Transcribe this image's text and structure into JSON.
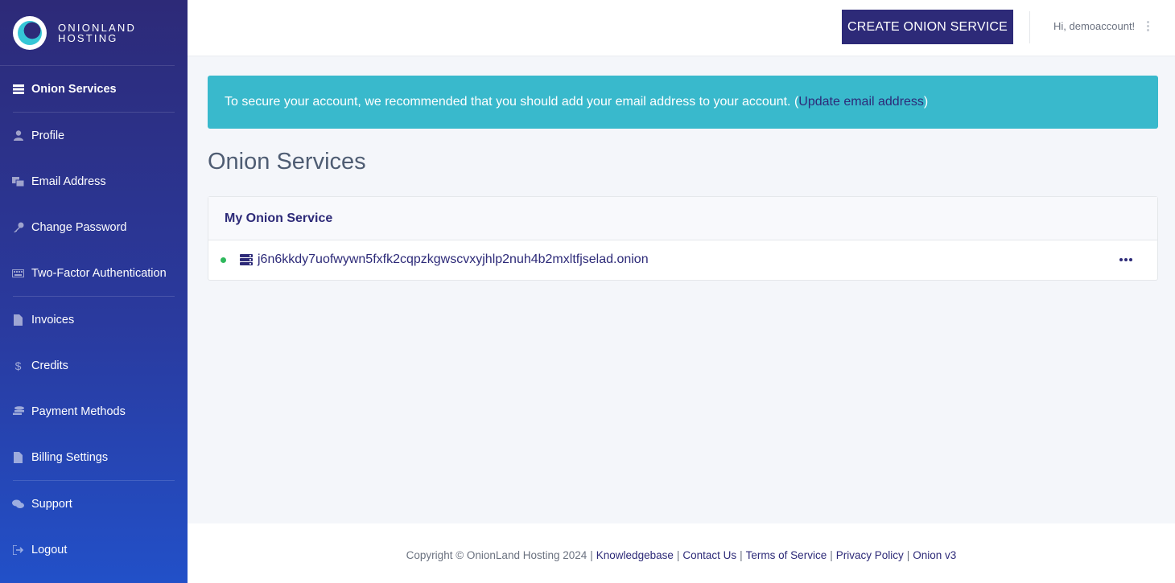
{
  "brand": {
    "line1": "ONIONLAND",
    "line2": "HOSTING"
  },
  "colors": {
    "primary": "#2d2a78",
    "alert": "#39b9cc",
    "status_online": "#2eb85c"
  },
  "sidebar": {
    "items": [
      {
        "label": "Onion Services",
        "icon": "server-icon"
      },
      {
        "label": "Profile",
        "icon": "user-icon"
      },
      {
        "label": "Email Address",
        "icon": "envelope-icon"
      },
      {
        "label": "Change Password",
        "icon": "key-icon"
      },
      {
        "label": "Two-Factor Authentication",
        "icon": "keyboard-icon"
      },
      {
        "label": "Invoices",
        "icon": "file-icon"
      },
      {
        "label": "Credits",
        "icon": "dollar-icon"
      },
      {
        "label": "Payment Methods",
        "icon": "coins-icon"
      },
      {
        "label": "Billing Settings",
        "icon": "file-icon"
      },
      {
        "label": "Support",
        "icon": "chat-icon"
      },
      {
        "label": "Logout",
        "icon": "logout-icon"
      }
    ]
  },
  "header": {
    "create_button": "CREATE ONION SERVICE",
    "greeting": "Hi, demoaccount!"
  },
  "alert": {
    "text_before": "To secure your account, we recommended that you should add your email address to your account. (",
    "link": "Update email address",
    "text_after": ")"
  },
  "main": {
    "title": "Onion Services",
    "card": {
      "header": "My Onion Service",
      "rows": [
        {
          "address": "j6n6kkdy7uofwywn5fxfk2cqpzkgwscvxyjhlp2nuh4b2mxltfjselad.onion"
        }
      ]
    }
  },
  "footer": {
    "copyright": "Copyright © OnionLand Hosting 2024",
    "links": [
      "Knowledgebase",
      "Contact Us",
      "Terms of Service",
      "Privacy Policy",
      "Onion v3"
    ]
  }
}
